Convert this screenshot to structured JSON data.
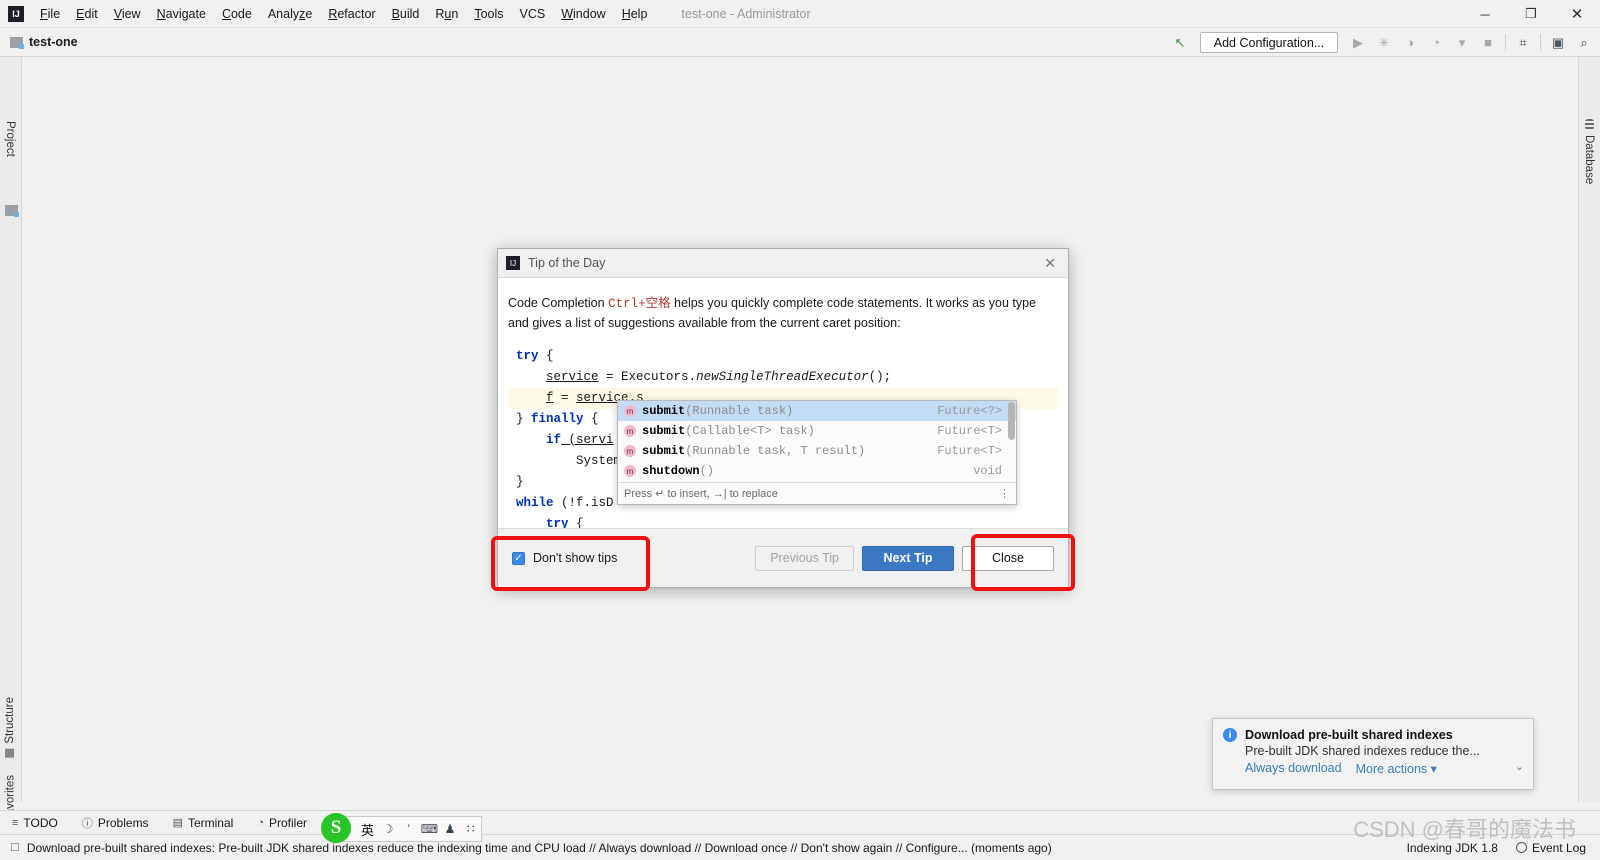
{
  "window": {
    "title": "test-one - Administrator",
    "logo": "intellij-logo",
    "minimize": "─",
    "maximize": "❐",
    "close": "✕"
  },
  "menubar": {
    "items": [
      {
        "label": "File"
      },
      {
        "label": "Edit"
      },
      {
        "label": "View"
      },
      {
        "label": "Navigate"
      },
      {
        "label": "Code"
      },
      {
        "label": "Analyze"
      },
      {
        "label": "Refactor"
      },
      {
        "label": "Build"
      },
      {
        "label": "Run"
      },
      {
        "label": "Tools"
      },
      {
        "label": "VCS"
      },
      {
        "label": "Window"
      },
      {
        "label": "Help"
      }
    ]
  },
  "navbar": {
    "project_name": "test-one",
    "folder_icon": "folder-icon"
  },
  "toolbar": {
    "build_label": "↖",
    "add_configuration": "Add Configuration...",
    "run_icon": "▶",
    "debug_icon": "✳",
    "run_coverage_icon": "◑",
    "profile_icon": "◔",
    "dropdown_icon": "▾",
    "stop_icon": "■",
    "project_structure_icon": "⌗",
    "terminal_icon": "▣",
    "search_icon": "⌕"
  },
  "sidebars": {
    "left_top": "Project",
    "left_bottom": [
      "Structure",
      "Favorites"
    ],
    "right_top": "Database"
  },
  "dialog": {
    "title": "Tip of the Day",
    "close_icon": "✕",
    "tip_intro_before": "Code Completion ",
    "tip_shortcut": "Ctrl+空格",
    "tip_intro_after": " helps you quickly complete code statements. It works as you type and gives a list of suggestions available from the current caret position:",
    "code": {
      "line1_kw": "try",
      "line1_rest": " {",
      "line2_a": "service",
      "line2_b": " = Executors.",
      "line2_c": "newSingleThreadExecutor",
      "line2_d": "();",
      "line3_a": "f",
      "line3_b": " = ",
      "line3_c": "service",
      "line3_d": ".s",
      "line4_a": "} ",
      "line4_kw": "finally",
      "line4_b": " {",
      "line5_kw": "if",
      "line5_rest": " (servi",
      "line6": "System.ou",
      "line7": "}",
      "line8_kw": "while",
      "line8_rest": " (!f.isD",
      "line9_kw": "try",
      "line9_rest": " {"
    },
    "autocomplete": {
      "method_badge": "m",
      "rows": [
        {
          "name": "submit",
          "args": "(Runnable task)",
          "type": "Future<?>",
          "selected": true
        },
        {
          "name": "submit",
          "args": "(Callable<T> task)",
          "type": "Future<T>",
          "selected": false
        },
        {
          "name": "submit",
          "args": "(Runnable task, T result)",
          "type": "Future<T>",
          "selected": false
        },
        {
          "name": "shutdown",
          "args": "()",
          "type": "void",
          "selected": false
        }
      ],
      "hint": "Press ↵ to insert, →| to replace",
      "more_icon": "⋮"
    },
    "footer": {
      "checkbox_checked": true,
      "checkbox_mark": "✓",
      "checkbox_label": "Don't show tips",
      "previous_label": "Previous Tip",
      "next_label": "Next Tip",
      "close_label": "Close"
    }
  },
  "annotations": {
    "color": "#ee1111",
    "regions": [
      "dont-show-tips-checkbox",
      "close-button"
    ]
  },
  "notification": {
    "info_icon": "i",
    "title": "Download pre-built shared indexes",
    "subtitle": "Pre-built JDK shared indexes reduce the...",
    "links": [
      "Always download",
      "More actions ▾"
    ],
    "expand_icon": "⌄"
  },
  "toolwindows": {
    "items": [
      {
        "label": "TODO",
        "icon": "≡"
      },
      {
        "label": "Problems",
        "icon": "ⓘ"
      },
      {
        "label": "Terminal",
        "icon": "▤"
      },
      {
        "label": "Profiler",
        "icon": "◔"
      }
    ]
  },
  "statusbar": {
    "icon": "☐",
    "message": "Download pre-built shared indexes: Pre-built JDK shared indexes reduce the indexing time and CPU load // Always download // Download once // Don't show again // Configure... (moments ago)",
    "indexing": "Indexing JDK 1.8",
    "event_log": "Event Log"
  },
  "ime": {
    "logo": "S",
    "icons": [
      "英",
      "☽",
      "’",
      "⌨",
      "♟",
      "∷"
    ]
  },
  "watermark": "CSDN @春哥的魔法书"
}
